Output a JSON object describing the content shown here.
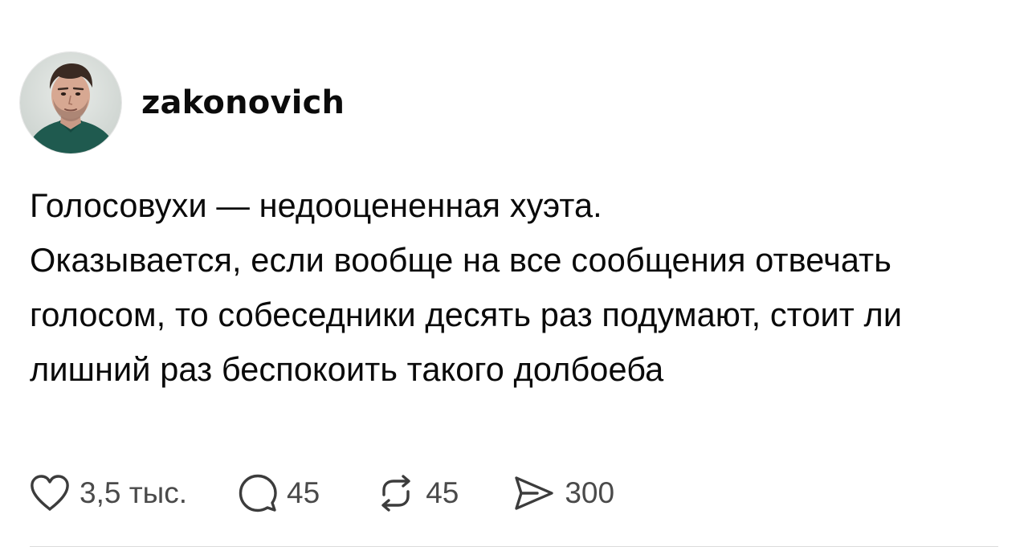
{
  "post": {
    "author": {
      "username": "zakonovich",
      "avatar_icon": "avatar-photo"
    },
    "text": {
      "line1": "Голосовухи — недооцененная хуэта.",
      "line2": "Оказывается, если вообще на все сообщения отвечать голосом, то собеседники десять раз подумают, стоит ли лишний раз беспокоить такого долбоеба"
    },
    "actions": {
      "like": {
        "icon": "heart-icon",
        "count": "3,5 тыс."
      },
      "reply": {
        "icon": "comment-bubble-icon",
        "count": "45"
      },
      "repost": {
        "icon": "repost-arrows-icon",
        "count": "45"
      },
      "share": {
        "icon": "send-icon",
        "count": "300"
      }
    },
    "colors": {
      "text": "#0a0a0a",
      "count": "#4a4a4a",
      "icon": "#3c3c3c",
      "divider": "#dcdcdc"
    }
  }
}
